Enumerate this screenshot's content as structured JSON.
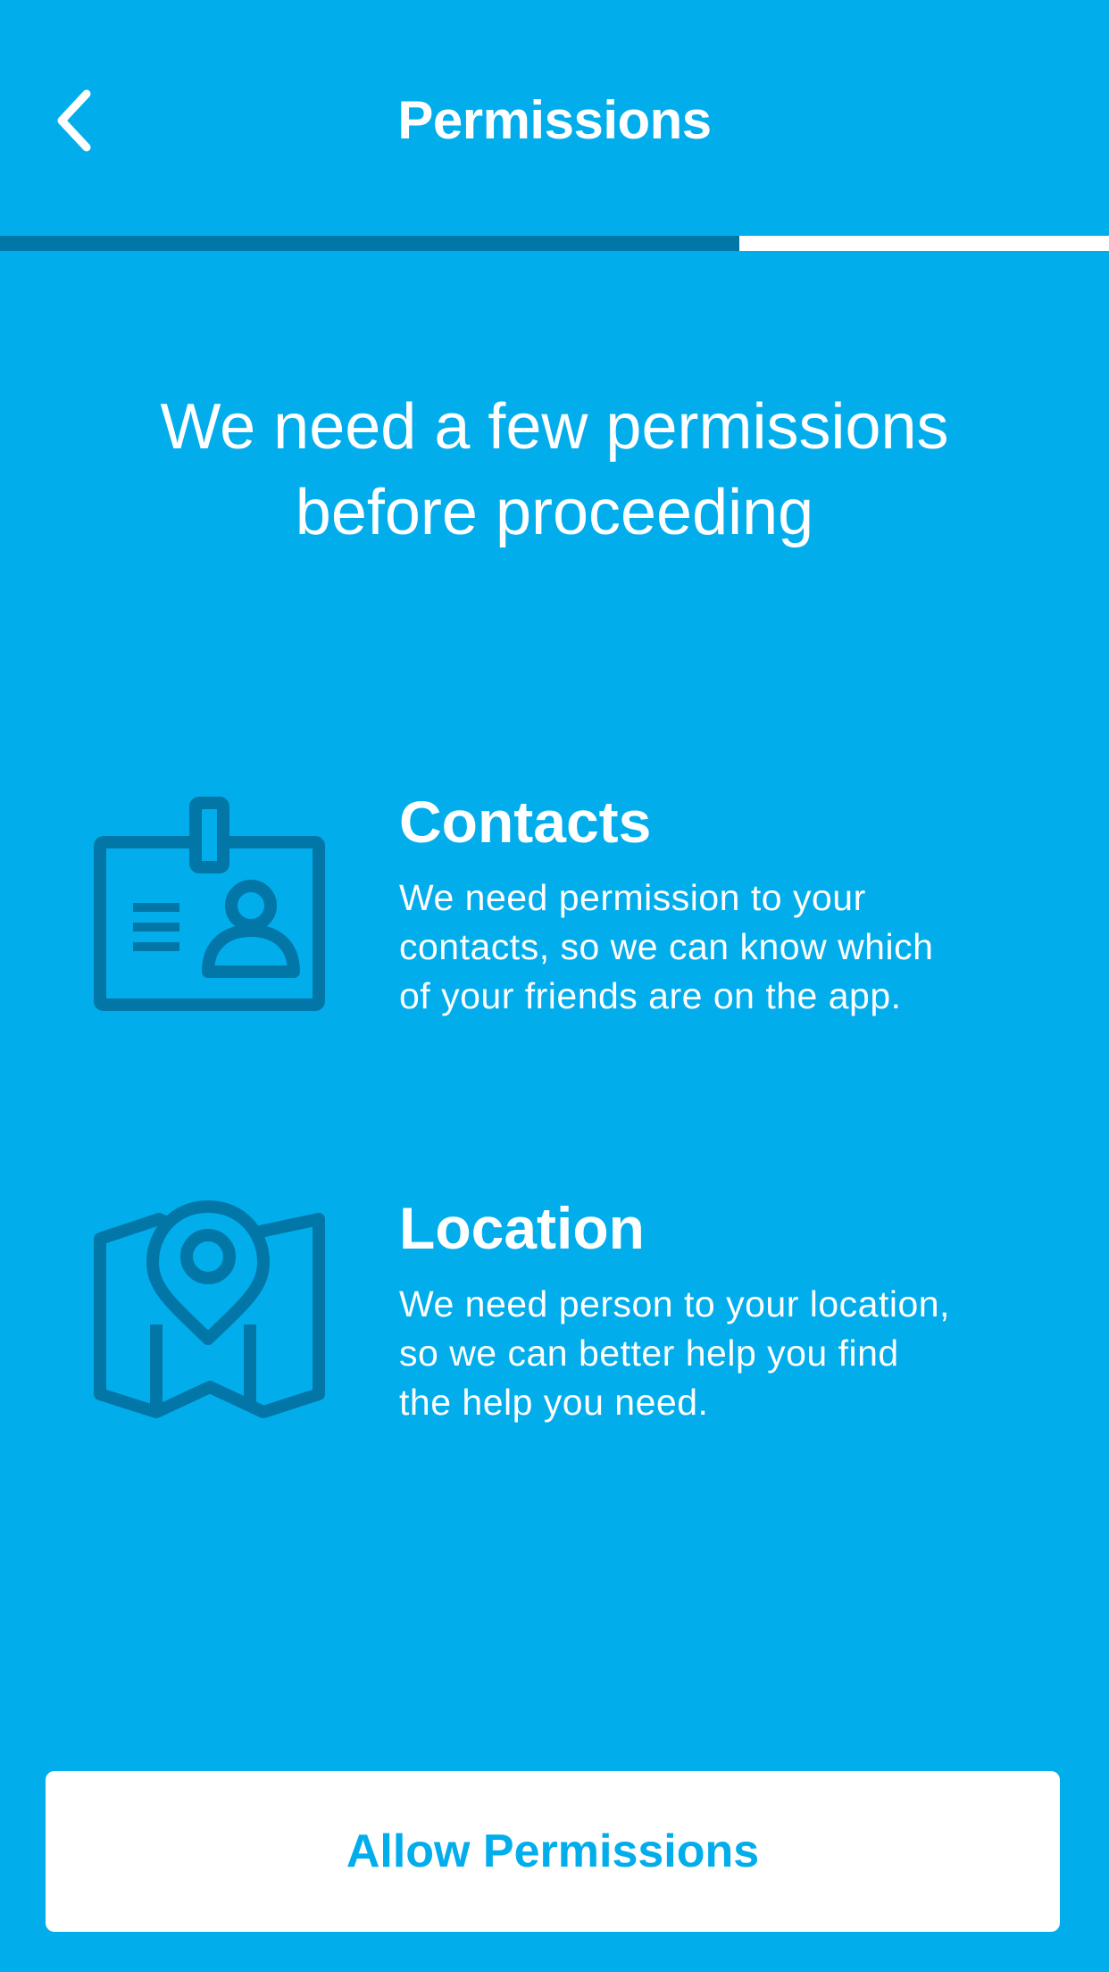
{
  "header": {
    "title": "Permissions",
    "back_icon": "chevron-left-icon"
  },
  "progress": {
    "fraction": 0.667,
    "fill_color": "#0276A6",
    "track_color": "#FFFFFF"
  },
  "intro": {
    "line1": "We need a few permissions",
    "line2": "before proceeding"
  },
  "permissions": [
    {
      "title": "Contacts",
      "icon": "id-badge-icon",
      "lines": [
        "We need permission to your",
        "contacts, so we can know which",
        "of your friends are on the app."
      ]
    },
    {
      "title": "Location",
      "icon": "map-pin-icon",
      "lines": [
        "We need person to your location,",
        "so we can better help you find",
        "the help you need."
      ]
    }
  ],
  "actions": {
    "allow_label": "Allow Permissions"
  },
  "colors": {
    "background": "#02ADEC",
    "icon": "#0276A6",
    "text": "#FFFFFF",
    "button_text": "#02ADEC"
  }
}
